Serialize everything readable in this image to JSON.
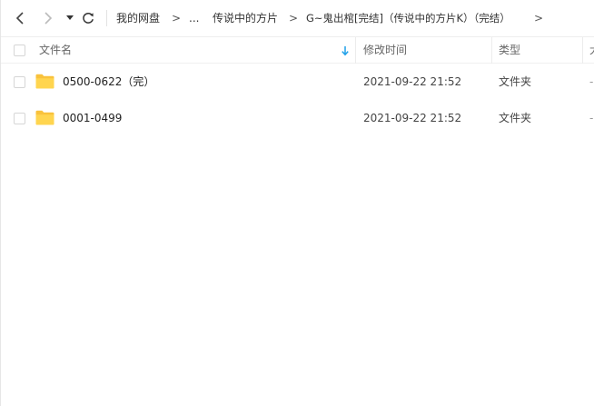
{
  "nav": {
    "back_icon": "chevron-left-icon",
    "forward_icon": "chevron-right-icon",
    "history_icon": "caret-down-icon",
    "refresh_icon": "refresh-icon"
  },
  "breadcrumb": {
    "items": [
      {
        "label": "我的网盘"
      },
      {
        "label": "..."
      },
      {
        "label": "传说中的方片"
      },
      {
        "label": "G~鬼出棺[完结]（传说中的方片K）（完结）"
      }
    ],
    "separator": ">"
  },
  "columns": {
    "name": "文件名",
    "modified": "修改时间",
    "type": "类型",
    "size": "大"
  },
  "files": [
    {
      "name": "0500-0622（完）",
      "modified": "2021-09-22 21:52",
      "type": "文件夹",
      "size": "-",
      "icon": "folder-icon"
    },
    {
      "name": "0001-0499",
      "modified": "2021-09-22 21:52",
      "type": "文件夹",
      "size": "-",
      "icon": "folder-icon"
    }
  ],
  "colors": {
    "folder": "#FFD54F",
    "folder_dark": "#F9C23C",
    "sort_arrow": "#1E9FE8"
  }
}
